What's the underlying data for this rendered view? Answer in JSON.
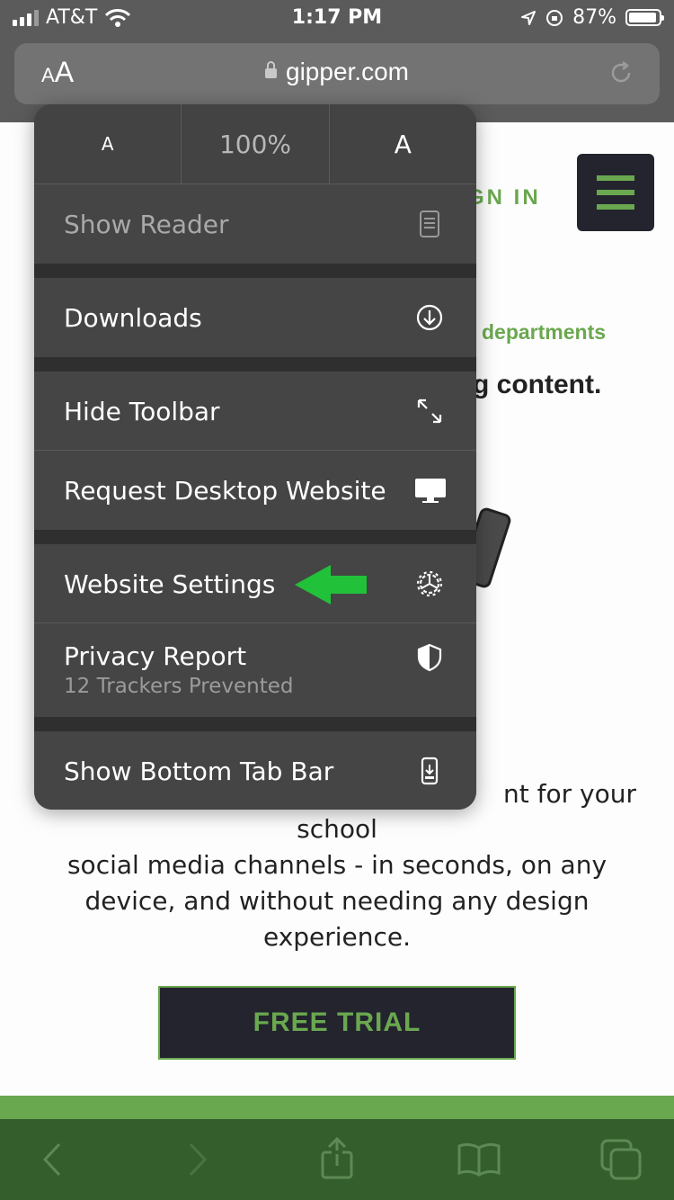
{
  "status_bar": {
    "carrier": "AT&T",
    "time": "1:17 PM",
    "battery": "87%",
    "icons": [
      "signal-icon",
      "wifi-icon",
      "location-icon",
      "orientation-lock-icon",
      "battery-icon"
    ]
  },
  "url_bar": {
    "text_size_label_small": "A",
    "text_size_label_big": "A",
    "domain": "gipper.com",
    "icons": [
      "lock-icon",
      "reload-icon"
    ]
  },
  "page": {
    "signin": "GN IN",
    "departments": "departments",
    "headline": "g content.",
    "body_partial": "nt for your",
    "body_line2": "school",
    "body_line3": "social media channels - in seconds, on any",
    "body_line4": "device, and without needing any design",
    "body_line5": "experience.",
    "cta": "FREE TRIAL",
    "colors": {
      "brand_green": "#6aa84f",
      "brand_dark": "#24242f"
    }
  },
  "menu": {
    "zoom_small": "A",
    "zoom_value": "100%",
    "zoom_large": "A",
    "show_reader": "Show Reader",
    "downloads": "Downloads",
    "hide_toolbar": "Hide Toolbar",
    "request_desktop": "Request Desktop Website",
    "website_settings": "Website Settings",
    "privacy_report": "Privacy Report",
    "privacy_sub": "12 Trackers Prevented",
    "show_bottom_tab_bar": "Show Bottom Tab Bar",
    "annotation_color": "#22c13a"
  },
  "toolbar": {
    "icons": [
      "back-icon",
      "forward-icon",
      "share-icon",
      "bookmarks-icon",
      "tabs-icon"
    ]
  }
}
